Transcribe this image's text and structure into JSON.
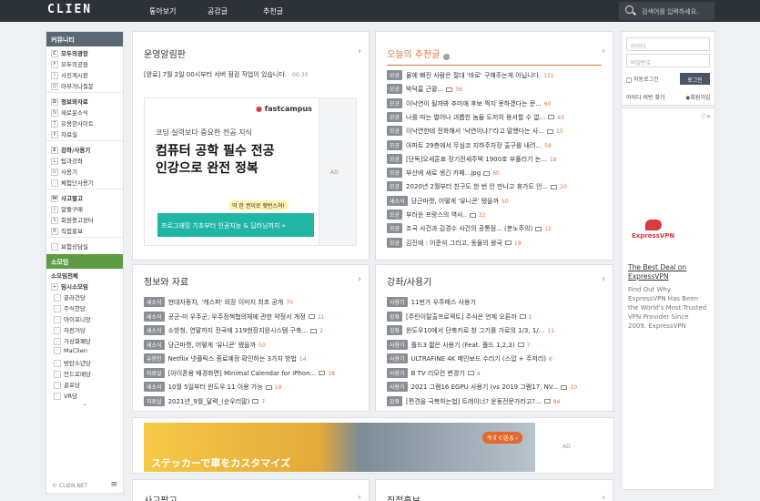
{
  "header": {
    "logo": "CLIEN",
    "nav": [
      "톺아보기",
      "공감글",
      "추천글"
    ],
    "search_placeholder": "검색어를 입력하세요."
  },
  "sidebar": {
    "community_head": "커뮤니티",
    "groups": [
      [
        {
          "k": "C",
          "t": "모두의광장",
          "b": true
        },
        {
          "k": "F",
          "t": "모두의공원"
        },
        {
          "k": "I",
          "t": "사진게시판"
        },
        {
          "k": "Q",
          "t": "아무거나질문"
        }
      ],
      [
        {
          "k": "D",
          "t": "정보와자료",
          "b": true
        },
        {
          "k": "N",
          "t": "새로운소식"
        },
        {
          "k": "T",
          "t": "유용한사이트"
        },
        {
          "k": "P",
          "t": "자료실"
        }
      ],
      [
        {
          "k": "E",
          "t": "강좌/사용기",
          "b": true
        },
        {
          "k": "L",
          "t": "팁과강좌"
        },
        {
          "k": "U",
          "t": "사용기"
        },
        {
          "k": "·",
          "t": "체험단사용기"
        }
      ],
      [
        {
          "k": "W",
          "t": "사고팔고",
          "b": true
        },
        {
          "k": "J",
          "t": "알뜰구매"
        },
        {
          "k": "S",
          "t": "회원중고장터"
        },
        {
          "k": "B",
          "t": "직접홍보"
        }
      ],
      [
        {
          "k": "·",
          "t": "보험상담실"
        }
      ]
    ],
    "somoim_head": "소모임",
    "somoim_all": "소모임전체",
    "somoim_sub": "임시소모임",
    "somoim_items": [
      "골라건당",
      "주식한당",
      "아이포니앙",
      "자전거당",
      "가상화폐당",
      "MaClien",
      "방탄소년당",
      "안드로메당",
      "골프당",
      "VR당"
    ],
    "footer": "© CLIEN.NET"
  },
  "notice": {
    "title": "운영알림판",
    "item": "[완료] 7월 2일 00시부터 서버 점검 작업이 있습니다.",
    "date": "06-30"
  },
  "ad1": {
    "brand": "fastcampus",
    "line1": "코딩 실력보다 중요한 전공 지식",
    "line2": "컴퓨터 공학 필수 전공",
    "line3": "인강으로 완전 정복",
    "badge": "딱 한 권이로 맺번스쳐!",
    "cta": "프로그래밍 기초부터 인공지능 & 딥러닝까지 »",
    "ad_label": "AD"
  },
  "recommend": {
    "title": "오늘의 추천글",
    "items": [
      {
        "tag": "모공",
        "t": "물에 빠진 사람은 절대 '바로' 구해주는게 아닙니다.",
        "c": "151"
      },
      {
        "tag": "모공",
        "t": "박덕흠 근황...",
        "c": "36",
        "img": true
      },
      {
        "tag": "모공",
        "t": "이낙연이 될까봐 추미애 후보 찍지 못하겠다는 문...",
        "c": "60"
      },
      {
        "tag": "모공",
        "t": "나를 따는 벌어나 괴롭힌 놈들 도저히 용서할 수 없...",
        "c": "43",
        "img": true
      },
      {
        "tag": "모공",
        "t": "이낙연한테 전화해서 '낙연이냐?'라고 말했다는 사...",
        "c": "15",
        "img": true
      },
      {
        "tag": "모공",
        "t": "아파트 29층에서 무심코 지하주차장 출구를 내려...",
        "c": "59"
      },
      {
        "tag": "모공",
        "t": "[단독]오세훈표 장기전세주택 1900호 부풀리기 논...",
        "c": "18"
      },
      {
        "tag": "모공",
        "t": "부산에 새로 생긴 카페...jpg",
        "c": "60",
        "img": true
      },
      {
        "tag": "모공",
        "t": "2020년 2월부터 친구도 한 번 안 만나고 휴가도 안...",
        "c": "20",
        "img": true
      },
      {
        "tag": "새소식",
        "t": "당근마켓, 어떻게 '유니콘' 됐을까",
        "c": "50"
      },
      {
        "tag": "모공",
        "t": "부러운 프랑스의 역사..",
        "c": "32",
        "img": true
      },
      {
        "tag": "모공",
        "t": "조국 사건과 김경수 사건의 공통점... (분노주의)",
        "c": "12",
        "img": true
      },
      {
        "tag": "모공",
        "t": "김진애 : 이준석 그리고, 동물의 왕국",
        "c": "19",
        "img": true
      }
    ]
  },
  "info": {
    "title": "정보와 자료",
    "items": [
      {
        "tag": "새소식",
        "t": "현대자동차, '캐스퍼' 외장 이미지 최초 공개",
        "c": "70"
      },
      {
        "tag": "새소식",
        "t": "공군-미 우주군, 우주정책협의체에 관한 약정서 개정",
        "c": "11",
        "img": true
      },
      {
        "tag": "새소식",
        "t": "소방청, 연말까지 전국에 119현장지원시스템 구축...",
        "c": "2",
        "img": true
      },
      {
        "tag": "새소식",
        "t": "당근마켓, 어떻게 '유니콘' 됐을까",
        "c": "50"
      },
      {
        "tag": "유용한",
        "t": "Netflix 넷플릭스 종료예정 확인하는 3가지 방법",
        "c": "14"
      },
      {
        "tag": "자료실",
        "t": "[아이폰용 배경화면] Minimal Calendar for iPhon...",
        "c": "18",
        "img": true
      },
      {
        "tag": "새소식",
        "t": "10월 5일부터 윈도우 11 이용 가능",
        "c": "19",
        "img": true
      },
      {
        "tag": "자료실",
        "t": "2021년_9월_달력_(순우리말)",
        "c": "7",
        "img": true
      }
    ]
  },
  "lecture": {
    "title": "강좌/사용기",
    "items": [
      {
        "tag": "사용기",
        "t": "11번가 우주패스 사용기",
        "c": ""
      },
      {
        "tag": "강좌",
        "t": "[주린이탈출프로젝트] 주식은 언제 오른까",
        "c": "1",
        "img": true
      },
      {
        "tag": "강좌",
        "t": "윈도우10에서 단축키로 창 그기를 가로의 1/3, 1/...",
        "c": "11"
      },
      {
        "tag": "사용기",
        "t": "폴드3 짧은 사용기 (Feat. 폴드 1,2,3)",
        "c": "7",
        "img": true
      },
      {
        "tag": "사용기",
        "t": "ULTRAFINE 4K 메인보드 수리기 (스압 + 주저리)",
        "c": "6"
      },
      {
        "tag": "사용기",
        "t": "B TV 리모컨 변경기",
        "c": "4",
        "img": true
      },
      {
        "tag": "사용기",
        "t": "2021 그램16 EGPU 사용기 (vs 2019 그램17, NV...",
        "c": "10",
        "img": true
      },
      {
        "tag": "강좌",
        "t": "[편견을 극복하는법] 트레이너? 운동전문가라고?...",
        "c": "84",
        "img": true
      }
    ]
  },
  "ad2": {
    "text": "ステッカーで車をカスタマイズ",
    "btn": "今すぐ送る ›",
    "ad_label": "AD"
  },
  "bottom_titles": [
    "사고팔고",
    "직접홍보"
  ],
  "login": {
    "id": "아이디",
    "pw": "비밀번호",
    "auto": "자동로그인",
    "btn": "로그인",
    "find": "아이디·비번 찾기",
    "join": "회원가입"
  },
  "right_ad": {
    "brand": "ExpressVPN",
    "headline": "The Best Deal on ExpressVPN",
    "body": "Find Out Why ExpressVPN Has Been the World's Most Trusted VPN Provider Since 2009. ExpressVPN"
  },
  "colors": {
    "accent": "#e5733a",
    "topbar": "#2d3138",
    "tag": "#8a8f96",
    "green": "#5d9c45"
  }
}
